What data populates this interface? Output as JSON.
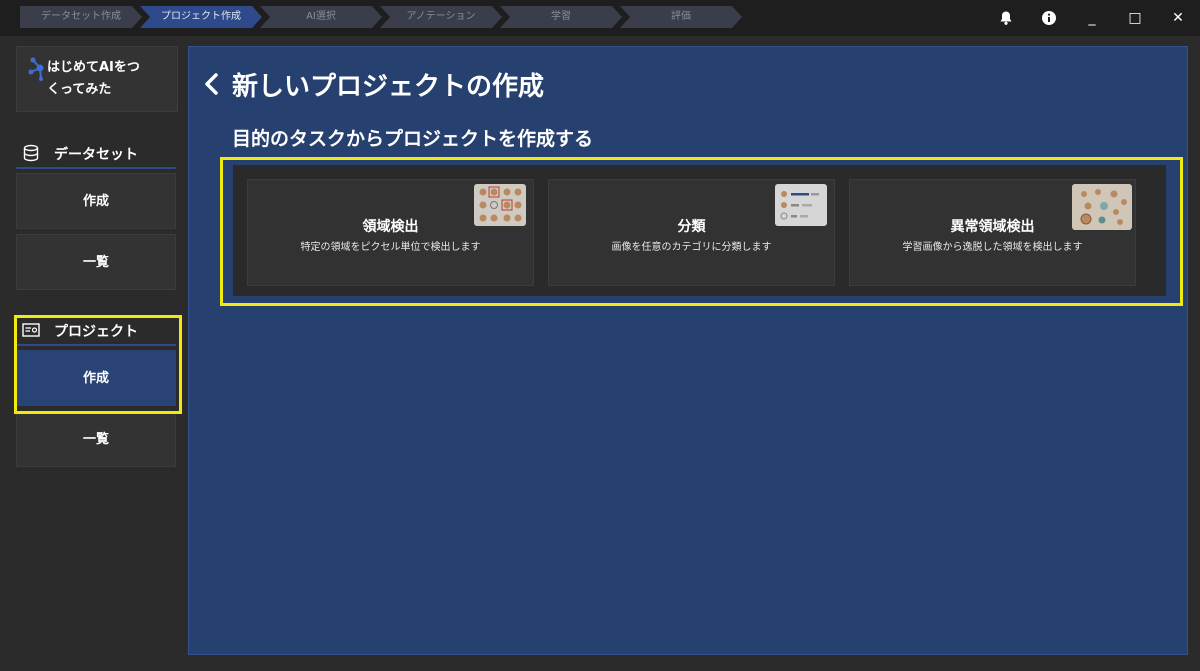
{
  "steps": [
    "データセット作成",
    "プロジェクト作成",
    "AI選択",
    "アノテーション",
    "学習",
    "評価"
  ],
  "active_step": 1,
  "window_controls": {
    "minimize": "_",
    "maximize": "□",
    "close": "✕"
  },
  "icons": {
    "bell": "bell-icon",
    "info": "info-icon",
    "logo": "logo-icon",
    "dataset": "database-icon",
    "project": "project-card-icon",
    "back": "chevron-left-icon"
  },
  "sidebar": {
    "logo_text_line1": "はじめてAIをつ",
    "logo_text_line2": "くってみた",
    "dataset": {
      "label": "データセット",
      "create": "作成",
      "list": "一覧"
    },
    "project": {
      "label": "プロジェクト",
      "create": "作成",
      "list": "一覧"
    }
  },
  "main": {
    "title": "新しいプロジェクトの作成",
    "subtitle": "目的のタスクからプロジェクトを作成する",
    "cards": [
      {
        "title": "領域検出",
        "desc": "特定の領域をピクセル単位で検出します"
      },
      {
        "title": "分類",
        "desc": "画像を任意のカテゴリに分類します"
      },
      {
        "title": "異常領域検出",
        "desc": "学習画像から逸脱した領域を検出します"
      }
    ]
  },
  "colors": {
    "accent": "#2f4a8a",
    "highlight": "#f2e90f",
    "main_bg": "#26406f",
    "app_bg": "#2b2b2b"
  }
}
